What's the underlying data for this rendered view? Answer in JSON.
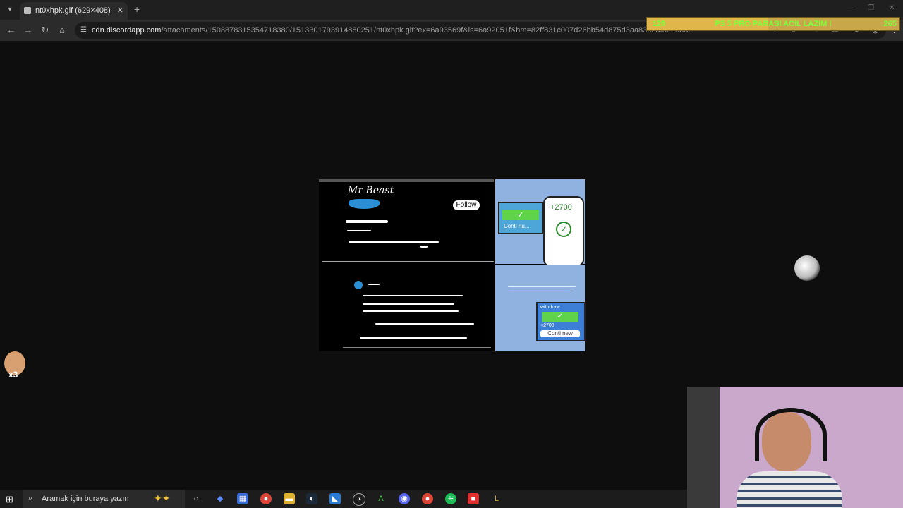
{
  "browser": {
    "tab": {
      "title": "nt0xhpk.gif (629×408)"
    },
    "new_tab_label": "+",
    "address": {
      "host": "cdn.discordapp.com",
      "path": "/attachments/1508878315354718380/1513301793914880251/nt0xhpk.gif?ex=6a93569f&is=6a92051f&hm=82ff831c007d26bb54d875d3aa83b2af8229b5f64924cf5d5cfd5..."
    }
  },
  "overlay": {
    "alert_left": "128",
    "alert_message": "PS 5 PRO PARASI ACİL LAZIM !",
    "alert_right": "265",
    "alert_progress": 0.48,
    "emote_multiplier": "x3"
  },
  "gif_content": {
    "handle": "Mr Beast",
    "follow_label": "Follow",
    "phone_amount": "+2700",
    "mini_card_label": "Conti nu...",
    "withdraw_label": "withdraw",
    "withdraw_amount": "+2700",
    "continue_label": "Conti new"
  },
  "taskbar": {
    "search_placeholder": "Aramak için buraya yazın"
  },
  "colors": {
    "background": "#0e0e0e",
    "alert_text": "#7cff3a",
    "alert_bg": "#e0b64b"
  }
}
